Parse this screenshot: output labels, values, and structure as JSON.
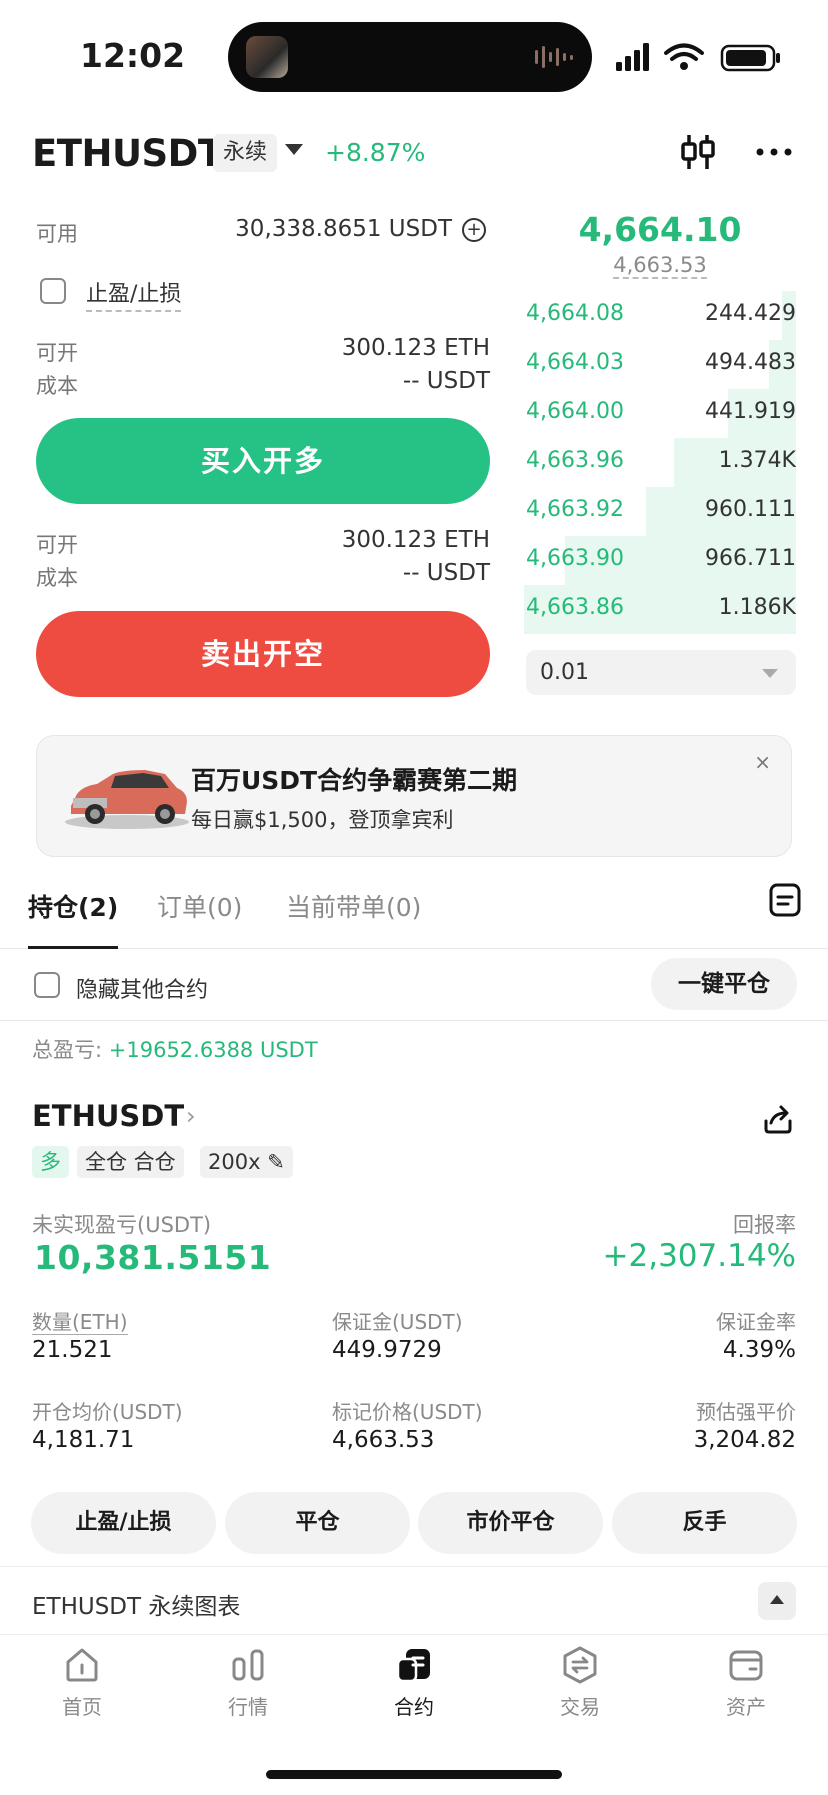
{
  "status_bar": {
    "time": "12:02"
  },
  "header": {
    "pair": "ETHUSDT",
    "contract_type": "永续",
    "change_pct": "+8.87%"
  },
  "form": {
    "available_label": "可用",
    "available_value": "30,338.8651 USDT",
    "tpsl_label": "止盈/止损",
    "tpsl_checked": false,
    "buy_block": {
      "max_label": "可开",
      "max_value": "300.123 ETH",
      "cost_label": "成本",
      "cost_value": "-- USDT"
    },
    "buy_button": "买入开多",
    "sell_block": {
      "max_label": "可开",
      "max_value": "300.123 ETH",
      "cost_label": "成本",
      "cost_value": "-- USDT"
    },
    "sell_button": "卖出开空"
  },
  "orderbook": {
    "last_price": "4,664.10",
    "mark_price": "4,663.53",
    "bids": [
      {
        "price": "4,664.08",
        "qty": "244.429",
        "depth": 0.05
      },
      {
        "price": "4,664.03",
        "qty": "494.483",
        "depth": 0.1
      },
      {
        "price": "4,664.00",
        "qty": "441.919",
        "depth": 0.25
      },
      {
        "price": "4,663.96",
        "qty": "1.374K",
        "depth": 0.45
      },
      {
        "price": "4,663.92",
        "qty": "960.111",
        "depth": 0.55
      },
      {
        "price": "4,663.90",
        "qty": "966.711",
        "depth": 0.85
      },
      {
        "price": "4,663.86",
        "qty": "1.186K",
        "depth": 1.0
      }
    ],
    "depth_step": "0.01"
  },
  "promo": {
    "title": "百万USDT合约争霸赛第二期",
    "subtitle": "每日赢$1,500，登顶拿宾利",
    "close": "×"
  },
  "tabs": [
    {
      "label": "持仓(2)"
    },
    {
      "label": "订单(0)"
    },
    {
      "label": "当前带单(0)"
    }
  ],
  "positions_bar": {
    "hide_label": "隐藏其他合约",
    "close_all": "一键平仓",
    "total_pnl_label": "总盈亏: ",
    "total_pnl_value": "+19652.6388 USDT"
  },
  "position": {
    "pair": "ETHUSDT",
    "chevron": "›",
    "side": "多",
    "margin_mode": "全仓 合仓",
    "leverage": "200x",
    "upnl_label": "未实现盈亏(USDT)",
    "upnl_value": "10,381.5151",
    "roe_label": "回报率",
    "roe_value": "+2,307.14%",
    "fields": {
      "qty_label": "数量(ETH)",
      "qty_value": "21.521",
      "margin_label": "保证金(USDT)",
      "margin_value": "449.9729",
      "margin_ratio_label": "保证金率",
      "margin_ratio_value": "4.39%",
      "entry_label": "开仓均价(USDT)",
      "entry_value": "4,181.71",
      "mark_label": "标记价格(USDT)",
      "mark_value": "4,663.53",
      "liq_label": "预估强平价",
      "liq_value": "3,204.82"
    },
    "actions": [
      "止盈/止损",
      "平仓",
      "市价平仓",
      "反手"
    ]
  },
  "chart_section": {
    "label": "ETHUSDT 永续图表"
  },
  "bottom_nav": [
    {
      "label": "首页",
      "icon": "home-icon"
    },
    {
      "label": "行情",
      "icon": "market-icon"
    },
    {
      "label": "合约",
      "icon": "futures-icon",
      "active": true
    },
    {
      "label": "交易",
      "icon": "trade-icon"
    },
    {
      "label": "资产",
      "icon": "wallet-icon"
    }
  ],
  "colors": {
    "green": "#25b97a",
    "buy": "#26c185",
    "sell": "#ef4c41"
  }
}
